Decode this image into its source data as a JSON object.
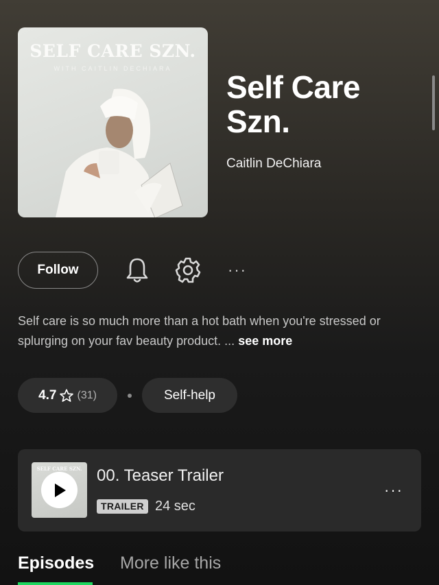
{
  "podcast": {
    "title": "Self Care Szn.",
    "author": "Caitlin DeChiara",
    "cover": {
      "title": "SELF CARE SZN.",
      "subtitle": "WITH CAITLIN DECHIARA"
    }
  },
  "actions": {
    "follow_label": "Follow",
    "bell_icon": "bell-icon",
    "gear_icon": "gear-icon",
    "more_label": "···"
  },
  "description": {
    "text": "Self care is so much more than a hot bath when you're stressed or splurging on your fav beauty product. ...",
    "see_more": "see more"
  },
  "rating": {
    "value": "4.7",
    "star_icon": "star-outline-icon",
    "count": "(31)"
  },
  "category": "Self-help",
  "trailer": {
    "title": "00. Teaser Trailer",
    "badge": "TRAILER",
    "duration": "24 sec",
    "thumb_text": "SELF CARE SZN.",
    "more_label": "···"
  },
  "tabs": [
    {
      "label": "Episodes",
      "active": true
    },
    {
      "label": "More like this",
      "active": false
    }
  ],
  "colors": {
    "accent": "#1ed760",
    "background": "#121212",
    "card": "#2a2a2a"
  }
}
